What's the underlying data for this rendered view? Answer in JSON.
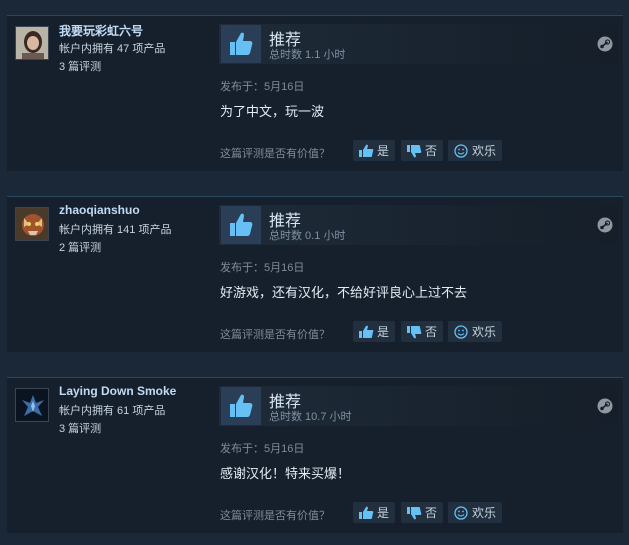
{
  "labels": {
    "recommended": "推荐",
    "helpful_prompt": "这篇评测是否有价值？",
    "yes": "是",
    "no": "否",
    "funny": "欢乐"
  },
  "reviews": [
    {
      "author": "我要玩彩虹六号",
      "products": "帐户内拥有 47 项产品",
      "review_count": "3 篇评测",
      "hours": "总时数 1.1 小时",
      "posted": "发布于：5月16日",
      "text": "为了中文，玩一波"
    },
    {
      "author": "zhaoqianshuo",
      "products": "帐户内拥有 141 项产品",
      "review_count": "2 篇评测",
      "hours": "总时数 0.1 小时",
      "posted": "发布于：5月16日",
      "text": "好游戏，还有汉化，不给好评良心上过不去"
    },
    {
      "author": "Laying Down Smoke",
      "products": "帐户内拥有 61 项产品",
      "review_count": "3 篇评测",
      "hours": "总时数 10.7 小时",
      "posted": "发布于：5月16日",
      "text": "感谢汉化！特来买爆！"
    }
  ],
  "colors": {
    "background": "#1b2838",
    "panel": "#16202d",
    "accent": "#66c0f4",
    "thumb_box": "#2a3f57"
  },
  "icons": {
    "recommend": "thumbs-up-icon",
    "platform": "steam-icon",
    "yes": "thumbs-up-icon",
    "no": "thumbs-down-icon",
    "funny": "smiley-icon"
  }
}
